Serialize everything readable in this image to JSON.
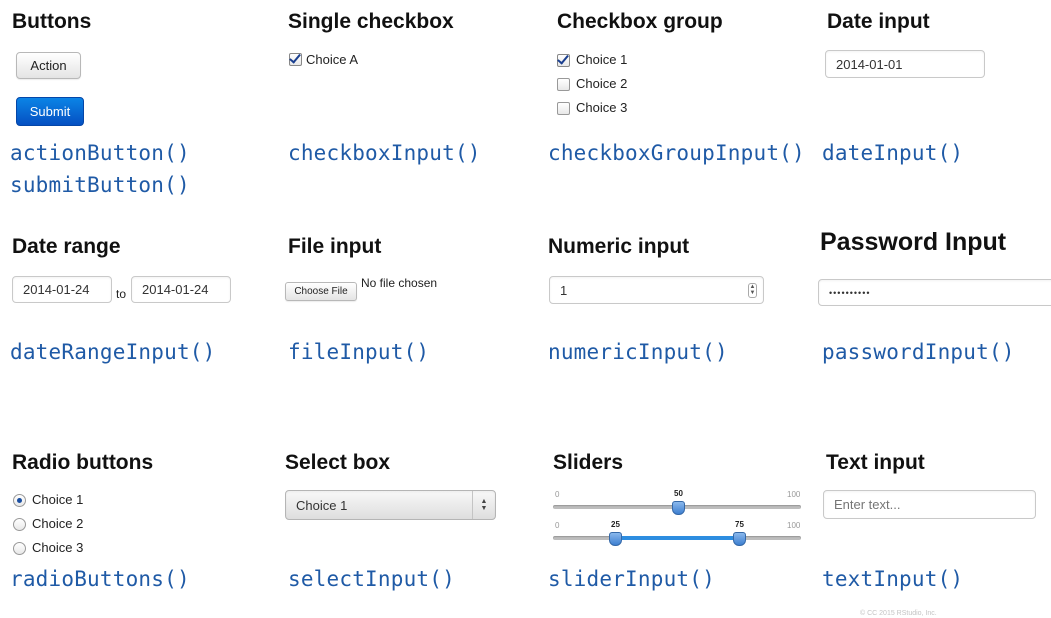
{
  "sections": {
    "buttons": {
      "title": "Buttons",
      "action_label": "Action",
      "submit_label": "Submit",
      "fn1": "actionButton()",
      "fn2": "submitButton()"
    },
    "single_checkbox": {
      "title": "Single checkbox",
      "label": "Choice A",
      "checked": true,
      "fn": "checkboxInput()"
    },
    "checkbox_group": {
      "title": "Checkbox group",
      "choices": [
        "Choice 1",
        "Choice 2",
        "Choice 3"
      ],
      "checked": [
        true,
        false,
        false
      ],
      "fn": "checkboxGroupInput()"
    },
    "date_input": {
      "title": "Date input",
      "value": "2014-01-01",
      "fn": "dateInput()"
    },
    "date_range": {
      "title": "Date range",
      "start": "2014-01-24",
      "separator": "to",
      "end": "2014-01-24",
      "fn": "dateRangeInput()"
    },
    "file_input": {
      "title": "File input",
      "button_label": "Choose File",
      "status": "No file chosen",
      "fn": "fileInput()"
    },
    "numeric_input": {
      "title": "Numeric input",
      "value": "1",
      "fn": "numericInput()"
    },
    "password_input": {
      "title": "Password Input",
      "value": "••••••••••",
      "fn": "passwordInput()"
    },
    "radio_buttons": {
      "title": "Radio buttons",
      "choices": [
        "Choice 1",
        "Choice 2",
        "Choice 3"
      ],
      "selected": "Choice 1",
      "fn": "radioButtons()"
    },
    "select_box": {
      "title": "Select box",
      "value": "Choice 1",
      "fn": "selectInput()"
    },
    "sliders": {
      "title": "Sliders",
      "slider1": {
        "min": "0",
        "max": "100",
        "value": "50"
      },
      "slider2": {
        "min": "0",
        "max": "100",
        "low": "25",
        "high": "75"
      },
      "fn": "sliderInput()"
    },
    "text_input": {
      "title": "Text input",
      "placeholder": "Enter text...",
      "fn": "textInput()"
    }
  },
  "footer": {
    "copyright": "© CC 2015 RStudio, Inc."
  },
  "colors": {
    "function_text": "#1f5aa6",
    "primary_button": "#0550c2",
    "slider_fill": "#2d8de0"
  }
}
